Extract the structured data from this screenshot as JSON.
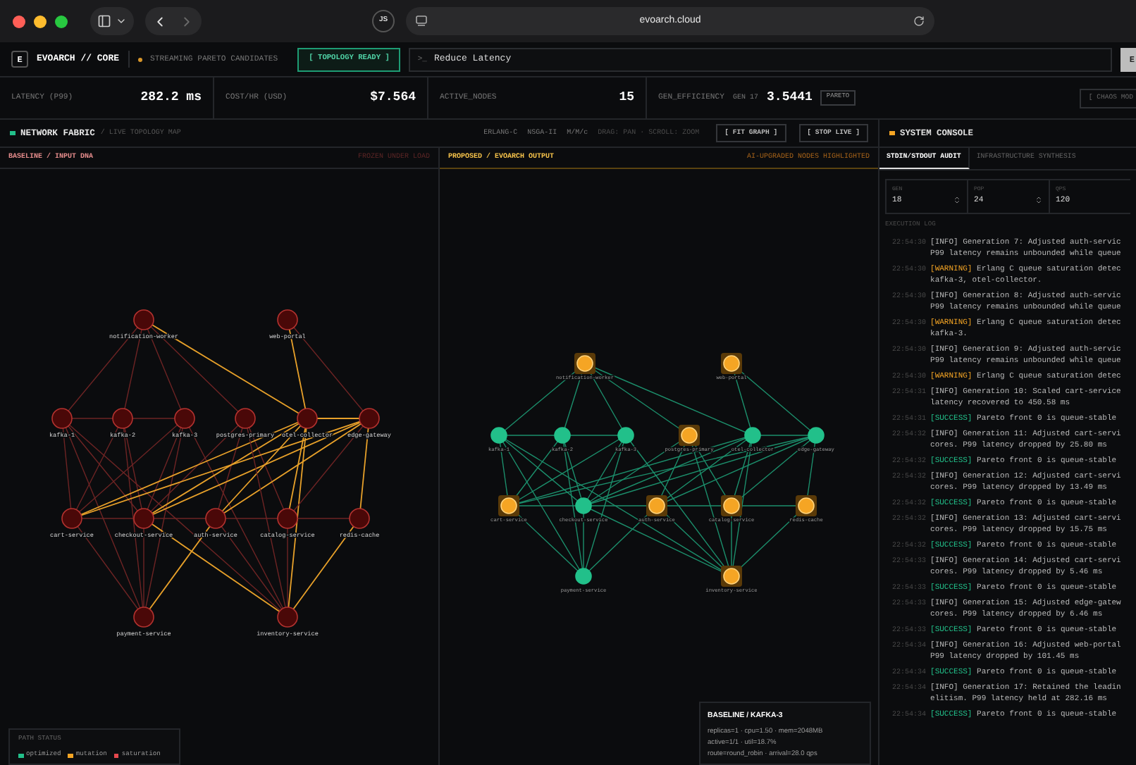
{
  "browser": {
    "address": "evoarch.cloud",
    "extension_label": "JS"
  },
  "header": {
    "logo": "E",
    "title": "EVOARCH // CORE",
    "stream_status": "STREAMING PARETO CANDIDATES",
    "topology_button": "[ TOPOLOGY READY ]",
    "prompt_prefix": ">_",
    "prompt_value": "Reduce Latency",
    "run_button": "E"
  },
  "metrics": [
    {
      "label": "LATENCY (P99)",
      "value": "282.2 ms"
    },
    {
      "label": "COST/HR (USD)",
      "value": "$7.564"
    },
    {
      "label": "ACTIVE_NODES",
      "value": "15"
    },
    {
      "label": "GEN_EFFICIENCY",
      "sub": "GEN 17",
      "value": "3.5441",
      "badge": "PARETO"
    }
  ],
  "chaos_button": "[ CHAOS MOD",
  "network": {
    "title": "NETWORK FABRIC",
    "subtitle": "/ LIVE TOPOLOGY MAP",
    "tags": [
      "ERLANG-C",
      "NSGA-II",
      "M/M/c",
      "DRAG: PAN · SCROLL: ZOOM"
    ],
    "buttons": [
      "[ FIT GRAPH ]",
      "[ STOP LIVE ]"
    ]
  },
  "baseline": {
    "title": "BASELINE / INPUT DNA",
    "note": "FROZEN UNDER LOAD",
    "nodes": [
      {
        "name": "notification-worker",
        "kind": "saturation"
      },
      {
        "name": "web-portal",
        "kind": "saturation"
      },
      {
        "name": "kafka-1",
        "kind": "saturation"
      },
      {
        "name": "kafka-2",
        "kind": "saturation"
      },
      {
        "name": "kafka-3",
        "kind": "saturation"
      },
      {
        "name": "postgres-primary",
        "kind": "saturation"
      },
      {
        "name": "otel-collector",
        "kind": "saturation"
      },
      {
        "name": "edge-gateway",
        "kind": "saturation"
      },
      {
        "name": "cart-service",
        "kind": "saturation"
      },
      {
        "name": "checkout-service",
        "kind": "saturation"
      },
      {
        "name": "auth-service",
        "kind": "saturation"
      },
      {
        "name": "catalog-service",
        "kind": "saturation"
      },
      {
        "name": "redis-cache",
        "kind": "saturation"
      },
      {
        "name": "payment-service",
        "kind": "saturation"
      },
      {
        "name": "inventory-service",
        "kind": "saturation"
      }
    ]
  },
  "proposed": {
    "title": "PROPOSED / EVOARCH OUTPUT",
    "note": "AI-UPGRADED NODES HIGHLIGHTED",
    "nodes": [
      {
        "name": "notification-worker",
        "kind": "mutation"
      },
      {
        "name": "web-portal",
        "kind": "mutation"
      },
      {
        "name": "kafka-1",
        "kind": "optimized"
      },
      {
        "name": "kafka-2",
        "kind": "optimized"
      },
      {
        "name": "kafka-3",
        "kind": "optimized"
      },
      {
        "name": "postgres-primary",
        "kind": "mutation"
      },
      {
        "name": "otel-collector",
        "kind": "optimized"
      },
      {
        "name": "edge-gateway",
        "kind": "optimized"
      },
      {
        "name": "cart-service",
        "kind": "mutation"
      },
      {
        "name": "checkout-service",
        "kind": "optimized"
      },
      {
        "name": "auth-service",
        "kind": "mutation"
      },
      {
        "name": "catalog-service",
        "kind": "mutation"
      },
      {
        "name": "redis-cache",
        "kind": "mutation"
      },
      {
        "name": "payment-service",
        "kind": "optimized"
      },
      {
        "name": "inventory-service",
        "kind": "mutation"
      }
    ],
    "inspector": {
      "title": "BASELINE / KAFKA-3",
      "lines": [
        "replicas=1 · cpu=1.50 · mem=2048MB",
        "active=1/1 · util=18.7%",
        "route=round_robin · arrival=28.0 qps"
      ]
    }
  },
  "legend": {
    "title": "PATH STATUS",
    "items": [
      {
        "label": "optimized",
        "color": "#22c08a"
      },
      {
        "label": "mutation",
        "color": "#f5a524"
      },
      {
        "label": "saturation",
        "color": "#e5484d"
      }
    ]
  },
  "console": {
    "title": "SYSTEM CONSOLE",
    "tabs": [
      {
        "label": "STDIN/STDOUT AUDIT",
        "selected": true
      },
      {
        "label": "INFRASTRUCTURE SYNTHESIS",
        "selected": false
      }
    ],
    "fields": [
      {
        "label": "GEN",
        "value": "18",
        "stepper": true
      },
      {
        "label": "POP",
        "value": "24",
        "stepper": true
      },
      {
        "label": "QPS",
        "value": "120",
        "stepper": false
      }
    ],
    "log_title": "EXECUTION LOG",
    "log": [
      {
        "time": "22:54:30",
        "kind": "info",
        "tag": "[INFO]",
        "lines": [
          "Generation 7: Adjusted auth-servic",
          "P99 latency remains unbounded while queue"
        ]
      },
      {
        "time": "22:54:30",
        "kind": "warning",
        "tag": "[WARNING]",
        "lines": [
          "Erlang C queue saturation detec",
          "kafka-3, otel-collector."
        ]
      },
      {
        "time": "22:54:30",
        "kind": "info",
        "tag": "[INFO]",
        "lines": [
          "Generation 8: Adjusted auth-servic",
          "P99 latency remains unbounded while queue"
        ]
      },
      {
        "time": "22:54:30",
        "kind": "warning",
        "tag": "[WARNING]",
        "lines": [
          "Erlang C queue saturation detec",
          "kafka-3."
        ]
      },
      {
        "time": "22:54:30",
        "kind": "info",
        "tag": "[INFO]",
        "lines": [
          "Generation 9: Adjusted auth-servic",
          "P99 latency remains unbounded while queue"
        ]
      },
      {
        "time": "22:54:30",
        "kind": "warning",
        "tag": "[WARNING]",
        "lines": [
          "Erlang C queue saturation detec"
        ]
      },
      {
        "time": "22:54:31",
        "kind": "info",
        "tag": "[INFO]",
        "lines": [
          "Generation 10: Scaled cart-service",
          "latency recovered to 450.58 ms"
        ]
      },
      {
        "time": "22:54:31",
        "kind": "success",
        "tag": "[SUCCESS]",
        "lines": [
          "Pareto front 0 is queue-stable"
        ]
      },
      {
        "time": "22:54:32",
        "kind": "info",
        "tag": "[INFO]",
        "lines": [
          "Generation 11: Adjusted cart-servi",
          "cores. P99 latency dropped by 25.80 ms"
        ]
      },
      {
        "time": "22:54:32",
        "kind": "success",
        "tag": "[SUCCESS]",
        "lines": [
          "Pareto front 0 is queue-stable"
        ]
      },
      {
        "time": "22:54:32",
        "kind": "info",
        "tag": "[INFO]",
        "lines": [
          "Generation 12: Adjusted cart-servi",
          "cores. P99 latency dropped by 13.49 ms"
        ]
      },
      {
        "time": "22:54:32",
        "kind": "success",
        "tag": "[SUCCESS]",
        "lines": [
          "Pareto front 0 is queue-stable"
        ]
      },
      {
        "time": "22:54:32",
        "kind": "info",
        "tag": "[INFO]",
        "lines": [
          "Generation 13: Adjusted cart-servi",
          "cores. P99 latency dropped by 15.75 ms"
        ]
      },
      {
        "time": "22:54:32",
        "kind": "success",
        "tag": "[SUCCESS]",
        "lines": [
          "Pareto front 0 is queue-stable"
        ]
      },
      {
        "time": "22:54:33",
        "kind": "info",
        "tag": "[INFO]",
        "lines": [
          "Generation 14: Adjusted cart-servi",
          "cores. P99 latency dropped by 5.46 ms"
        ]
      },
      {
        "time": "22:54:33",
        "kind": "success",
        "tag": "[SUCCESS]",
        "lines": [
          "Pareto front 0 is queue-stable"
        ]
      },
      {
        "time": "22:54:33",
        "kind": "info",
        "tag": "[INFO]",
        "lines": [
          "Generation 15: Adjusted edge-gatew",
          "cores. P99 latency dropped by 6.46 ms"
        ]
      },
      {
        "time": "22:54:33",
        "kind": "success",
        "tag": "[SUCCESS]",
        "lines": [
          "Pareto front 0 is queue-stable"
        ]
      },
      {
        "time": "22:54:34",
        "kind": "info",
        "tag": "[INFO]",
        "lines": [
          "Generation 16: Adjusted web-portal",
          "P99 latency dropped by 101.45 ms"
        ]
      },
      {
        "time": "22:54:34",
        "kind": "success",
        "tag": "[SUCCESS]",
        "lines": [
          "Pareto front 0 is queue-stable"
        ]
      },
      {
        "time": "22:54:34",
        "kind": "info",
        "tag": "[INFO]",
        "lines": [
          "Generation 17: Retained the leadin",
          "elitism. P99 latency held at 282.16 ms"
        ]
      },
      {
        "time": "22:54:34",
        "kind": "success",
        "tag": "[SUCCESS]",
        "lines": [
          "Pareto front 0 is queue-stable"
        ]
      }
    ]
  }
}
